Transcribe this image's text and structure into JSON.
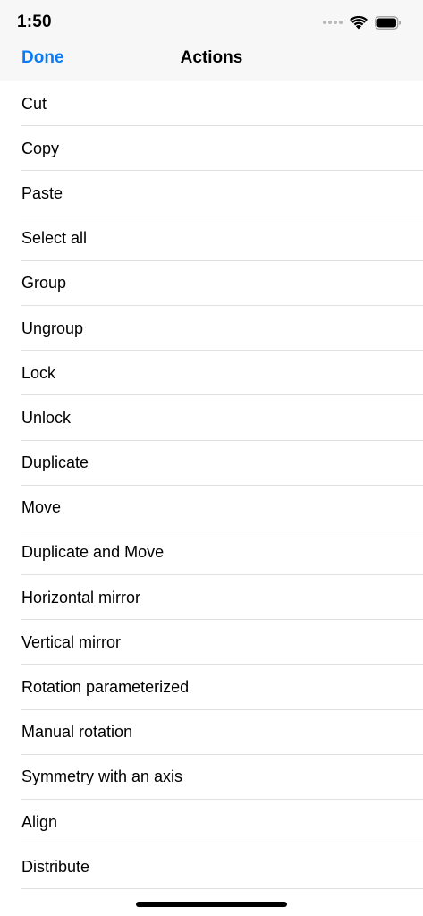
{
  "status_bar": {
    "time": "1:50",
    "icons": [
      "signal-dots-icon",
      "wifi-icon",
      "battery-icon"
    ]
  },
  "nav": {
    "done_label": "Done",
    "title": "Actions",
    "accent_color": "#0a7bf5"
  },
  "actions": [
    {
      "label": "Cut"
    },
    {
      "label": "Copy"
    },
    {
      "label": "Paste"
    },
    {
      "label": "Select all"
    },
    {
      "label": "Group"
    },
    {
      "label": "Ungroup"
    },
    {
      "label": "Lock"
    },
    {
      "label": "Unlock"
    },
    {
      "label": "Duplicate"
    },
    {
      "label": "Move"
    },
    {
      "label": "Duplicate and Move"
    },
    {
      "label": "Horizontal mirror"
    },
    {
      "label": "Vertical mirror"
    },
    {
      "label": "Rotation parameterized"
    },
    {
      "label": "Manual rotation"
    },
    {
      "label": "Symmetry with an axis"
    },
    {
      "label": "Align"
    },
    {
      "label": "Distribute"
    }
  ]
}
